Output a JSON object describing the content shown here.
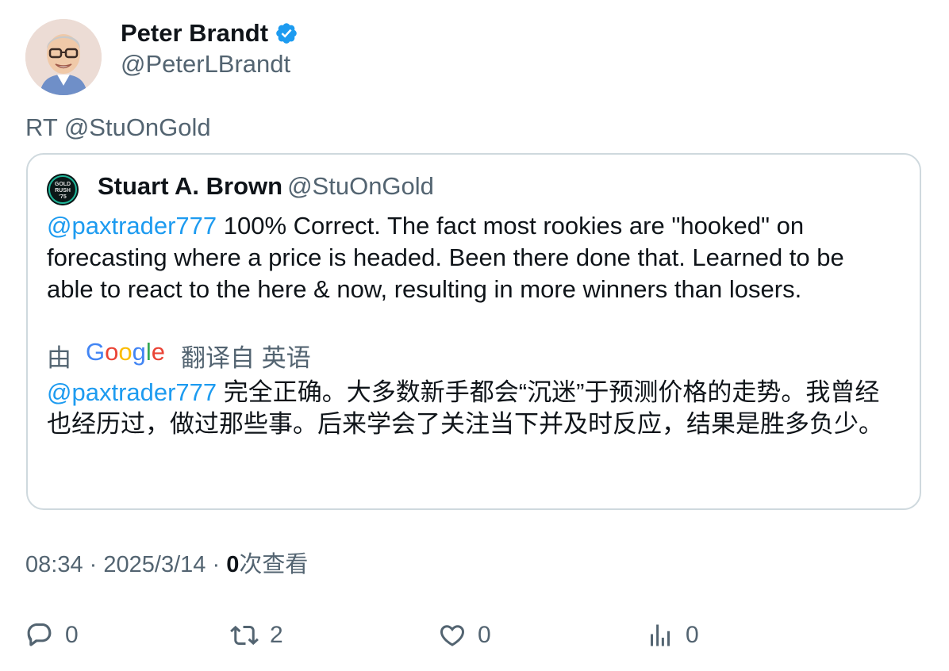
{
  "tweet": {
    "author_name": "Peter Brandt",
    "author_handle": "@PeterLBrandt",
    "rt_text": "RT @StuOnGold",
    "avatar_icon": "cartoon-portrait-avatar",
    "verified_icon": "verified-badge-icon"
  },
  "quote": {
    "author_name": "Stuart A. Brown",
    "author_handle": "@StuOnGold",
    "avatar_text_1": "GOLD",
    "avatar_text_2": "RUSH",
    "avatar_text_3": "'75",
    "mention": "@paxtrader777",
    "text": " 100% Correct. The fact most rookies are \"hooked\" on forecasting where a price is headed. Been there done that. Learned to be able to react to the here & now, resulting in more winners than losers.",
    "translate_prefix": "由",
    "translate_brand": "Google",
    "translate_suffix": "翻译自 英语",
    "translated_mention": "@paxtrader777",
    "translated_text": " 完全正确。大多数新手都会“沉迷”于预测价格的走势。我曾经也经历过，做过那些事。后来学会了关注当下并及时反应，结果是胜多负少。"
  },
  "meta": {
    "time": "08:34",
    "separator": "·",
    "date": "2025/3/14",
    "views_count": "0",
    "views_label": "次查看"
  },
  "actions": {
    "reply_count": "0",
    "retweet_count": "2",
    "like_count": "0",
    "views_count": "0"
  },
  "colors": {
    "accent": "#1d9bf0",
    "secondary_text": "#536471",
    "border": "#cfd9de"
  }
}
